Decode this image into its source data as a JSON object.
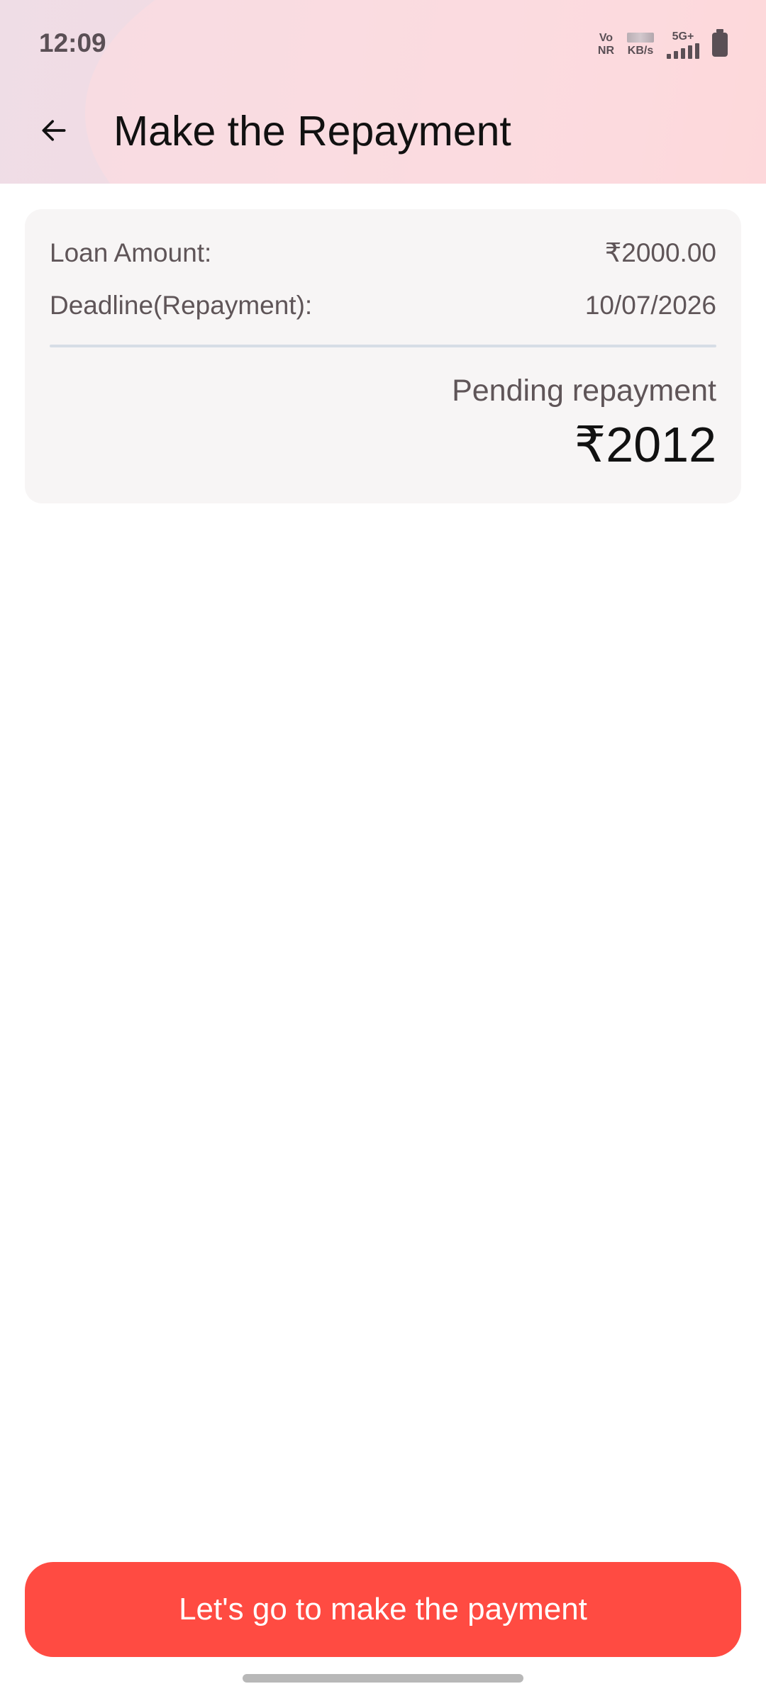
{
  "status_bar": {
    "time": "12:09",
    "volte_top": "Vo",
    "volte_bottom": "NR",
    "speed_unit": "KB/s",
    "network": "5G+",
    "icons": [
      "volte-icon",
      "data-speed-icon",
      "signal-icon",
      "battery-icon"
    ]
  },
  "header": {
    "title": "Make the Repayment",
    "back_icon": "arrow-left-icon"
  },
  "loan_card": {
    "loan_amount_label": "Loan Amount:",
    "loan_amount_value": "₹2000.00",
    "deadline_label": "Deadline(Repayment):",
    "deadline_value": "10/07/2026",
    "pending_label": "Pending repayment",
    "pending_value": "₹2012"
  },
  "actions": {
    "pay_button_label": "Let's go to make the payment"
  },
  "colors": {
    "accent": "#ff4b42",
    "card_bg": "#f7f5f5",
    "header_gradient_start": "#efdde6",
    "header_gradient_end": "#fbd3d4"
  }
}
